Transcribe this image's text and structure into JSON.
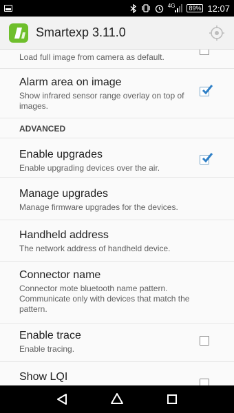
{
  "status_bar": {
    "network": "4G",
    "battery": "89%",
    "time": "12:07",
    "icons": [
      "image-icon",
      "bluetooth-icon",
      "vibrate-icon",
      "alarm-icon",
      "signal-icon",
      "battery-icon"
    ]
  },
  "app_bar": {
    "title": "Smartexp 3.11.0",
    "logo_color": "#6fbf2c",
    "action_icon": "locate-icon"
  },
  "preferences": {
    "load_full_image": {
      "summary": "Load full image from camera as default.",
      "checked": false
    },
    "alarm_area": {
      "title": "Alarm area on image",
      "summary": "Show infrared sensor range overlay on top of images.",
      "checked": true
    },
    "advanced_header": "ADVANCED",
    "enable_upgrades": {
      "title": "Enable upgrades",
      "summary": "Enable upgrading devices over the air.",
      "checked": true
    },
    "manage_upgrades": {
      "title": "Manage upgrades",
      "summary": "Manage firmware upgrades for the devices."
    },
    "handheld_address": {
      "title": "Handheld address",
      "summary": "The network address of handheld device."
    },
    "connector_name": {
      "title": "Connector name",
      "summary": "Connector mote bluetooth name pattern. Communicate only with devices that match the pattern."
    },
    "enable_trace": {
      "title": "Enable trace",
      "summary": "Enable tracing.",
      "checked": false
    },
    "show_lqi": {
      "title": "Show LQI",
      "checked": false
    }
  },
  "nav_bar": {
    "icons": [
      "back-icon",
      "home-icon",
      "recents-icon"
    ]
  },
  "colors": {
    "accent": "#2f80c7",
    "status_bar": "#000000",
    "app_bar": "#f2f2f2"
  }
}
